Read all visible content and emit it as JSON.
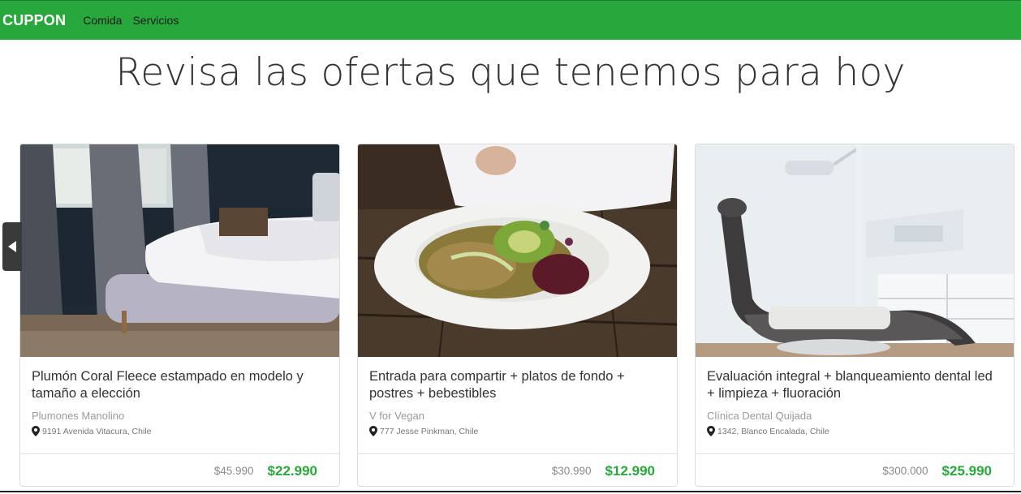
{
  "navbar": {
    "brand": "CUPPON",
    "links": [
      "Comida",
      "Servicios"
    ],
    "accent_color": "#28a83c"
  },
  "headline": "Revisa las ofertas que tenemos para hoy",
  "carousel": {
    "prev_icon": "triangle-left-icon"
  },
  "cards": [
    {
      "image": "bedroom-photo",
      "title": "Plumón Coral Fleece estampado en modelo y tamaño a elección",
      "shop": "Plumones Manolino",
      "location": "9191 Avenida Vitacura, Chile",
      "old_price": "$45.990",
      "new_price": "$22.990"
    },
    {
      "image": "salad-bowl-photo",
      "title": "Entrada para compartir + platos de fondo + postres + bebestibles",
      "shop": "V for Vegan",
      "location": "777 Jesse Pinkman, Chile",
      "old_price": "$30.990",
      "new_price": "$12.990"
    },
    {
      "image": "dental-chair-photo",
      "title": "Evaluación integral + blanqueamiento dental led + limpieza + fluoración",
      "shop": "Clínica Dental Quijada",
      "location": "1342, Blanco Encalada, Chile",
      "old_price": "$300.000",
      "new_price": "$25.990"
    }
  ]
}
